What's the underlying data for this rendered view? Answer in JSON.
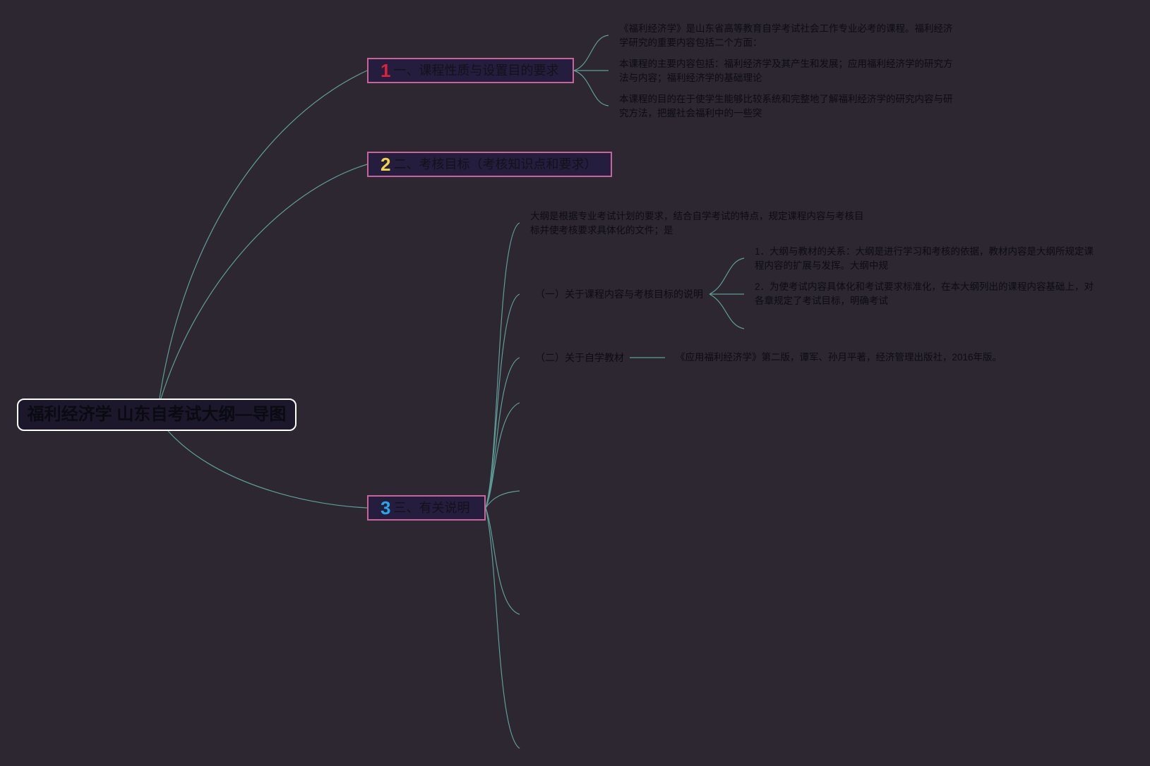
{
  "root": {
    "title": "福利经济学 山东自考试大纲—导图"
  },
  "branches": [
    {
      "number": "1",
      "number_color": "#e0203c",
      "label": "一、课程性质与设置目的要求",
      "children": [
        "《福利经济学》是山东省高等教育自学考试社会工作专业必考的课程。福利经济\n学研究的重要内容包括二个方面：",
        "本课程的主要内容包括：福利经济学及其产生和发展；应用福利经济学的研究方\n法与内容；福利经济学的基础理论",
        "本课程的目的在于使学生能够比较系统和完整地了解福利经济学的研究内容与研\n究方法，把握社会福利中的一些突"
      ]
    },
    {
      "number": "2",
      "number_color": "#f2d24a",
      "label": "二、考核目标（考核知识点和要求）"
    },
    {
      "number": "3",
      "number_color": "#2aa6e8",
      "label": "三、有关说明",
      "intro": "大纲是根据专业考试计划的要求，结合自学考试的特点，规定课程内容与考核目\n标并使考核要求具体化的文件；是",
      "sub1": {
        "label": "（一）关于课程内容与考核目标的说明",
        "children": [
          "1．大纲与教材的关系：大纲是进行学习和考核的依据，教材内容是大纲所规定课\n程内容的扩展与发挥。大纲中规",
          "2．为使考试内容具体化和考试要求标准化，在本大纲列出的课程内容基础上，对\n各章规定了考试目标，明确考试"
        ]
      },
      "sub2": {
        "label": "（二）关于自学教材",
        "child": "《应用福利经济学》第二版，谭军、孙月平著，经济管理出版社，2016年版。"
      }
    }
  ]
}
